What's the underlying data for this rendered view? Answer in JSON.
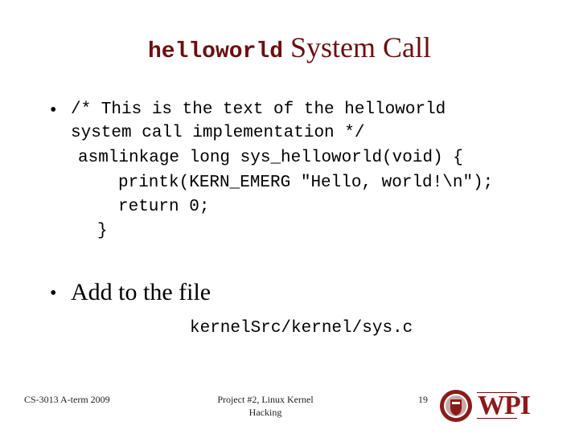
{
  "title": {
    "code_part": "helloworld",
    "text_part": " System Call"
  },
  "bullet1": {
    "bullet": "•",
    "lines": [
      "/* This is the text of the helloworld",
      "system call implementation */",
      "asmlinkage long sys_helloworld(void) {",
      "printk(KERN_EMERG \"Hello, world!\\n\");",
      "return 0;",
      "}"
    ]
  },
  "bullet2": {
    "bullet": "•",
    "text": "Add to the file",
    "path": "kernelSrc/kernel/sys.c"
  },
  "footer": {
    "course": "CS-3013 A-term 2009",
    "project_line1": "Project #2, Linux Kernel",
    "project_line2": "Hacking",
    "page_number": "19",
    "logo_text": "WPI"
  },
  "colors": {
    "title": "#6b0f0f",
    "logo": "#8b1a1a"
  }
}
